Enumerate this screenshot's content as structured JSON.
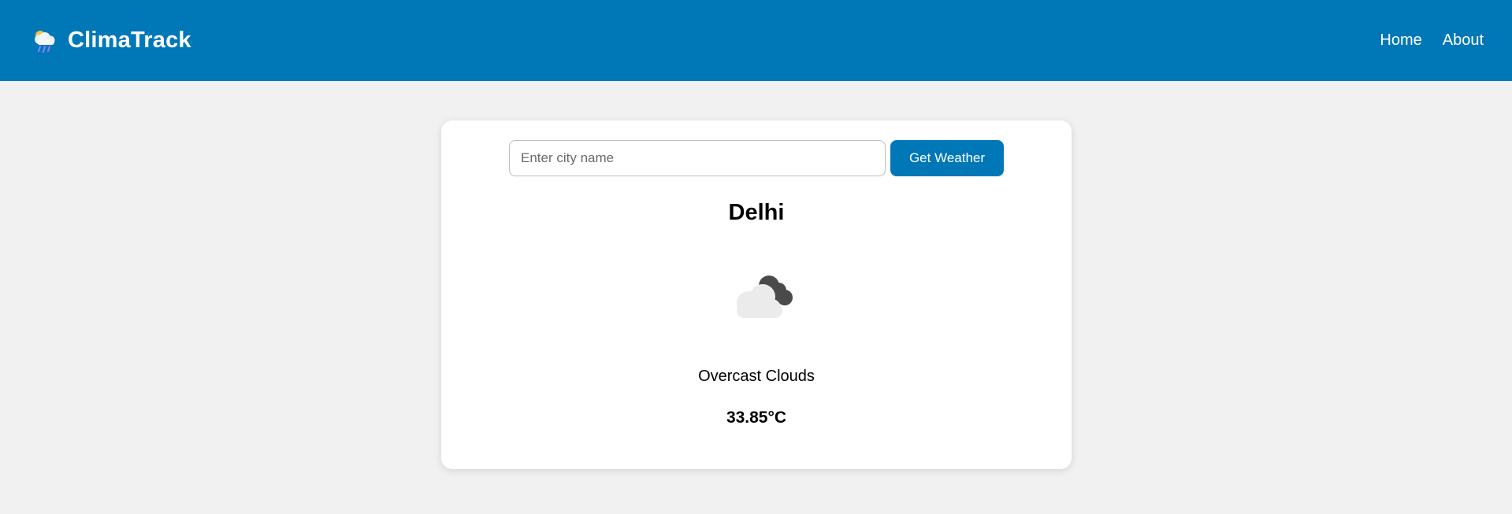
{
  "header": {
    "brand_name": "ClimaTrack",
    "nav": [
      {
        "label": "Home"
      },
      {
        "label": "About"
      }
    ]
  },
  "search": {
    "placeholder": "Enter city name",
    "value": "",
    "button_label": "Get Weather"
  },
  "weather": {
    "city": "Delhi",
    "icon": "overcast-clouds-icon",
    "description": "Overcast Clouds",
    "temperature": "33.85°C"
  },
  "colors": {
    "header_bg": "#0078b8",
    "accent": "#0078b8",
    "page_bg": "#f1f1f1",
    "card_bg": "#ffffff"
  }
}
